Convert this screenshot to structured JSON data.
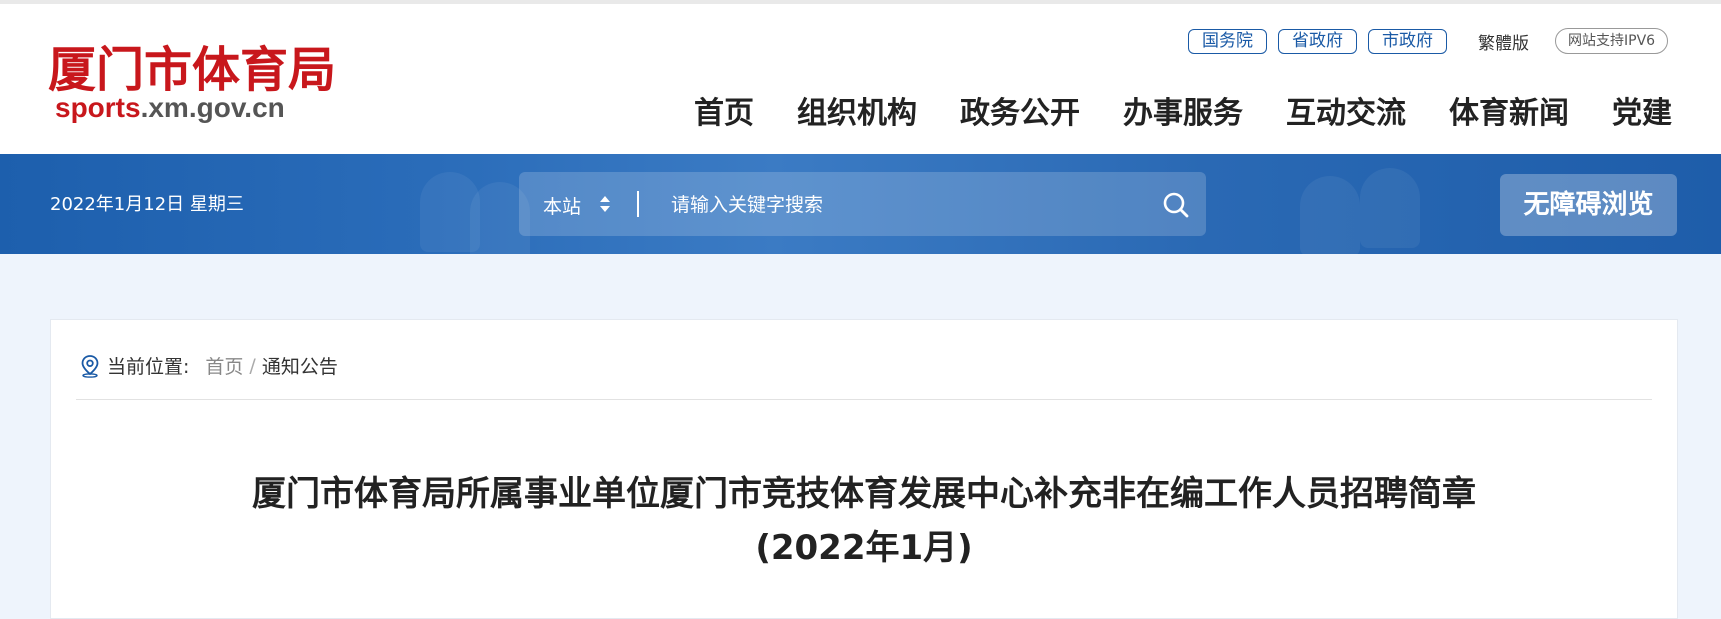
{
  "header": {
    "logo_cn": "厦门市体育局",
    "logo_en_red": "sports",
    "logo_en_rest": ".xm.gov.cn",
    "gov_links": [
      "国务院",
      "省政府",
      "市政府"
    ],
    "traditional_label": "繁體版",
    "ipv6_label": "网站支持IPV6",
    "nav": [
      "首页",
      "组织机构",
      "政务公开",
      "办事服务",
      "互动交流",
      "体育新闻",
      "党建"
    ]
  },
  "banner": {
    "date": "2022年1月12日 星期三",
    "search": {
      "scope": "本站",
      "placeholder": "请输入关键字搜索"
    },
    "accessibility_label": "无障碍浏览"
  },
  "breadcrumb": {
    "label": "当前位置:",
    "home": "首页",
    "separator": "/",
    "current": "通知公告"
  },
  "article": {
    "title": "厦门市体育局所属事业单位厦门市竞技体育发展中心补充非在编工作人员招聘简章",
    "subtitle": "(2022年1月)"
  },
  "colors": {
    "brand_red": "#c8171c",
    "brand_blue": "#1a5aa6",
    "banner_blue": "#2a6cb9",
    "page_bg": "#eef4fc"
  },
  "icons": [
    "location-pin-icon",
    "sort-arrows-icon",
    "search-icon"
  ]
}
